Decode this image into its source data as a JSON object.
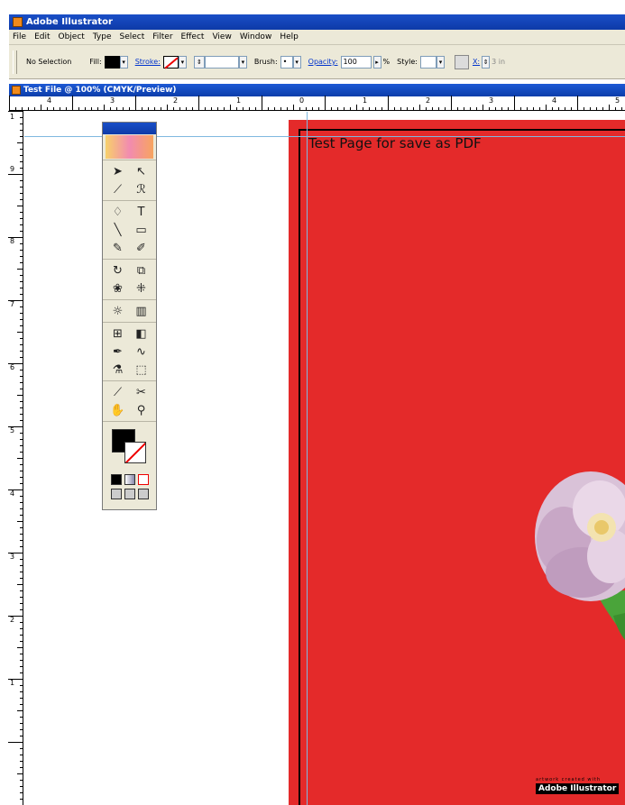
{
  "app": {
    "title": "Adobe Illustrator",
    "logo_icon": "illustrator-logo-icon"
  },
  "menu": [
    "File",
    "Edit",
    "Object",
    "Type",
    "Select",
    "Filter",
    "Effect",
    "View",
    "Window",
    "Help"
  ],
  "control_bar": {
    "selection": "No Selection",
    "fill_label": "Fill:",
    "stroke_label": "Stroke:",
    "brush_label": "Brush:",
    "opacity_label": "Opacity:",
    "opacity_value": "100",
    "opacity_unit": "%",
    "style_label": "Style:",
    "units_value": "3 in"
  },
  "document": {
    "title": "Test File @ 100% (CMYK/Preview)"
  },
  "ruler_h": [
    "4",
    "3",
    "2",
    "1",
    "0",
    "1",
    "2",
    "3",
    "4",
    "5"
  ],
  "ruler_v": [
    "1",
    "9",
    "8",
    "7",
    "6",
    "5",
    "4",
    "3",
    "2",
    "1"
  ],
  "artboard": {
    "text": "Test Page for save as PDF",
    "brand_tagline": "artwork created with",
    "brand_name": "Adobe Illustrator"
  },
  "colors": {
    "artboard": "#e42a2a",
    "title_bar": "#0d3aa8",
    "guide": "#7fb8e0"
  }
}
